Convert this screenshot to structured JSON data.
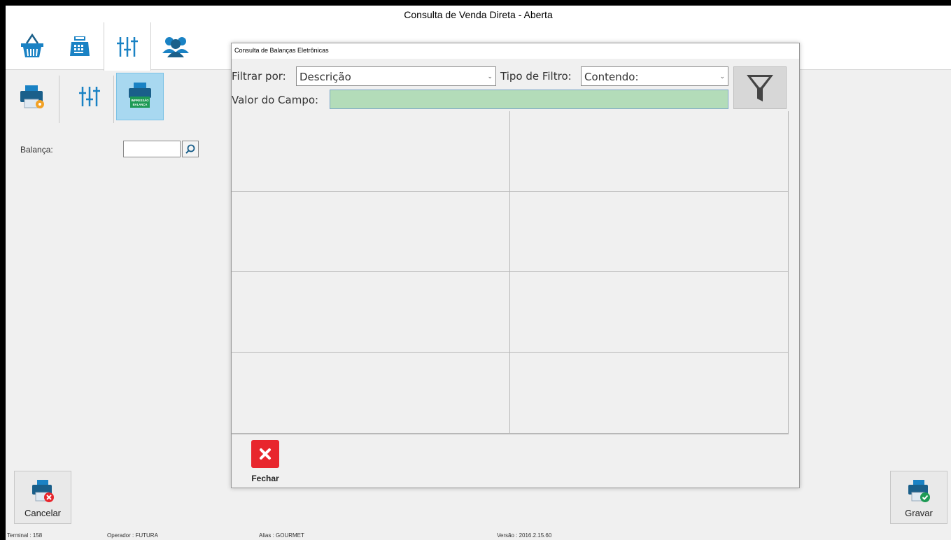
{
  "window": {
    "title": "Consulta de Venda Direta - Aberta"
  },
  "main_tabs": [
    {
      "icon": "basket-icon"
    },
    {
      "icon": "cash-register-icon"
    },
    {
      "icon": "sliders-icon",
      "active": true
    },
    {
      "icon": "users-icon"
    }
  ],
  "sub_tabs": [
    {
      "icon": "printer-settings-icon"
    },
    {
      "icon": "sliders-icon"
    },
    {
      "icon": "scale-printer-icon",
      "badge": "IMPRESSÃO BALANÇA",
      "active": true
    }
  ],
  "form": {
    "balanca_label": "Balança:",
    "balanca_value": ""
  },
  "dialog": {
    "title": "Consulta de Balanças Eletrônicas",
    "filtrar_por_label": "Filtrar por:",
    "filtrar_por_value": "Descrição",
    "tipo_filtro_label": "Tipo de Filtro:",
    "tipo_filtro_value": "Contendo:",
    "valor_label": "Valor do Campo:",
    "valor_value": "",
    "fechar_label": "Fechar"
  },
  "buttons": {
    "cancelar_label": "Cancelar",
    "gravar_label": "Gravar"
  },
  "status": {
    "terminal": "Terminal :  158",
    "operador": "Operador :  FUTURA",
    "alias": "Alias :  GOURMET",
    "versao": "Versão :  2016.2.15.60"
  },
  "colors": {
    "accent_blue": "#1a82c4",
    "active_subtab": "#a8d8f0",
    "valor_field": "#b3dcb9",
    "fechar_red": "#e8262d",
    "green_badge": "#1e9a55"
  }
}
